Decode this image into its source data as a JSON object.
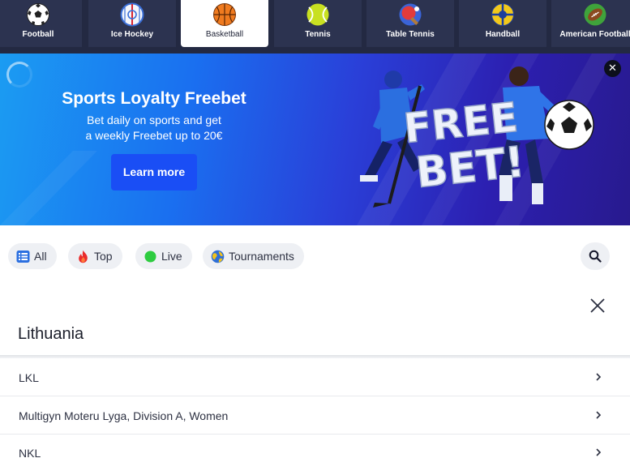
{
  "sports_nav": {
    "tabs": [
      {
        "label": "Football",
        "icon": "football-icon",
        "active": false
      },
      {
        "label": "Ice Hockey",
        "icon": "ice-hockey-icon",
        "active": false
      },
      {
        "label": "Basketball",
        "icon": "basketball-icon",
        "active": true
      },
      {
        "label": "Tennis",
        "icon": "tennis-icon",
        "active": false
      },
      {
        "label": "Table Tennis",
        "icon": "table-tennis-icon",
        "active": false
      },
      {
        "label": "Handball",
        "icon": "handball-icon",
        "active": false
      },
      {
        "label": "American Football",
        "icon": "american-football-icon",
        "active": false
      }
    ]
  },
  "banner": {
    "title": "Sports Loyalty Freebet",
    "subtitle_line1": "Bet daily on sports and get",
    "subtitle_line2": "a weekly Freebet up to 20€",
    "cta_label": "Learn more",
    "art_text_line1": "FREE",
    "art_text_line2": "BET!",
    "close_icon": "close-icon"
  },
  "filters": {
    "chips": [
      {
        "label": "All",
        "icon": "list-icon"
      },
      {
        "label": "Top",
        "icon": "fire-icon"
      },
      {
        "label": "Live",
        "icon": "live-dot-icon"
      },
      {
        "label": "Tournaments",
        "icon": "globe-icon"
      }
    ],
    "search_icon": "search-icon"
  },
  "region": {
    "title": "Lithuania",
    "leagues": [
      {
        "name": "LKL"
      },
      {
        "name": "Multigyn Moteru Lyga, Division A, Women"
      },
      {
        "name": "NKL"
      }
    ]
  },
  "colors": {
    "nav_background": "#232942",
    "tab_background": "#2c3350",
    "active_tab": "#ffffff",
    "cta_blue": "#1a4ef5",
    "chip_background": "#eef0f4",
    "live_green": "#2ecc40"
  }
}
